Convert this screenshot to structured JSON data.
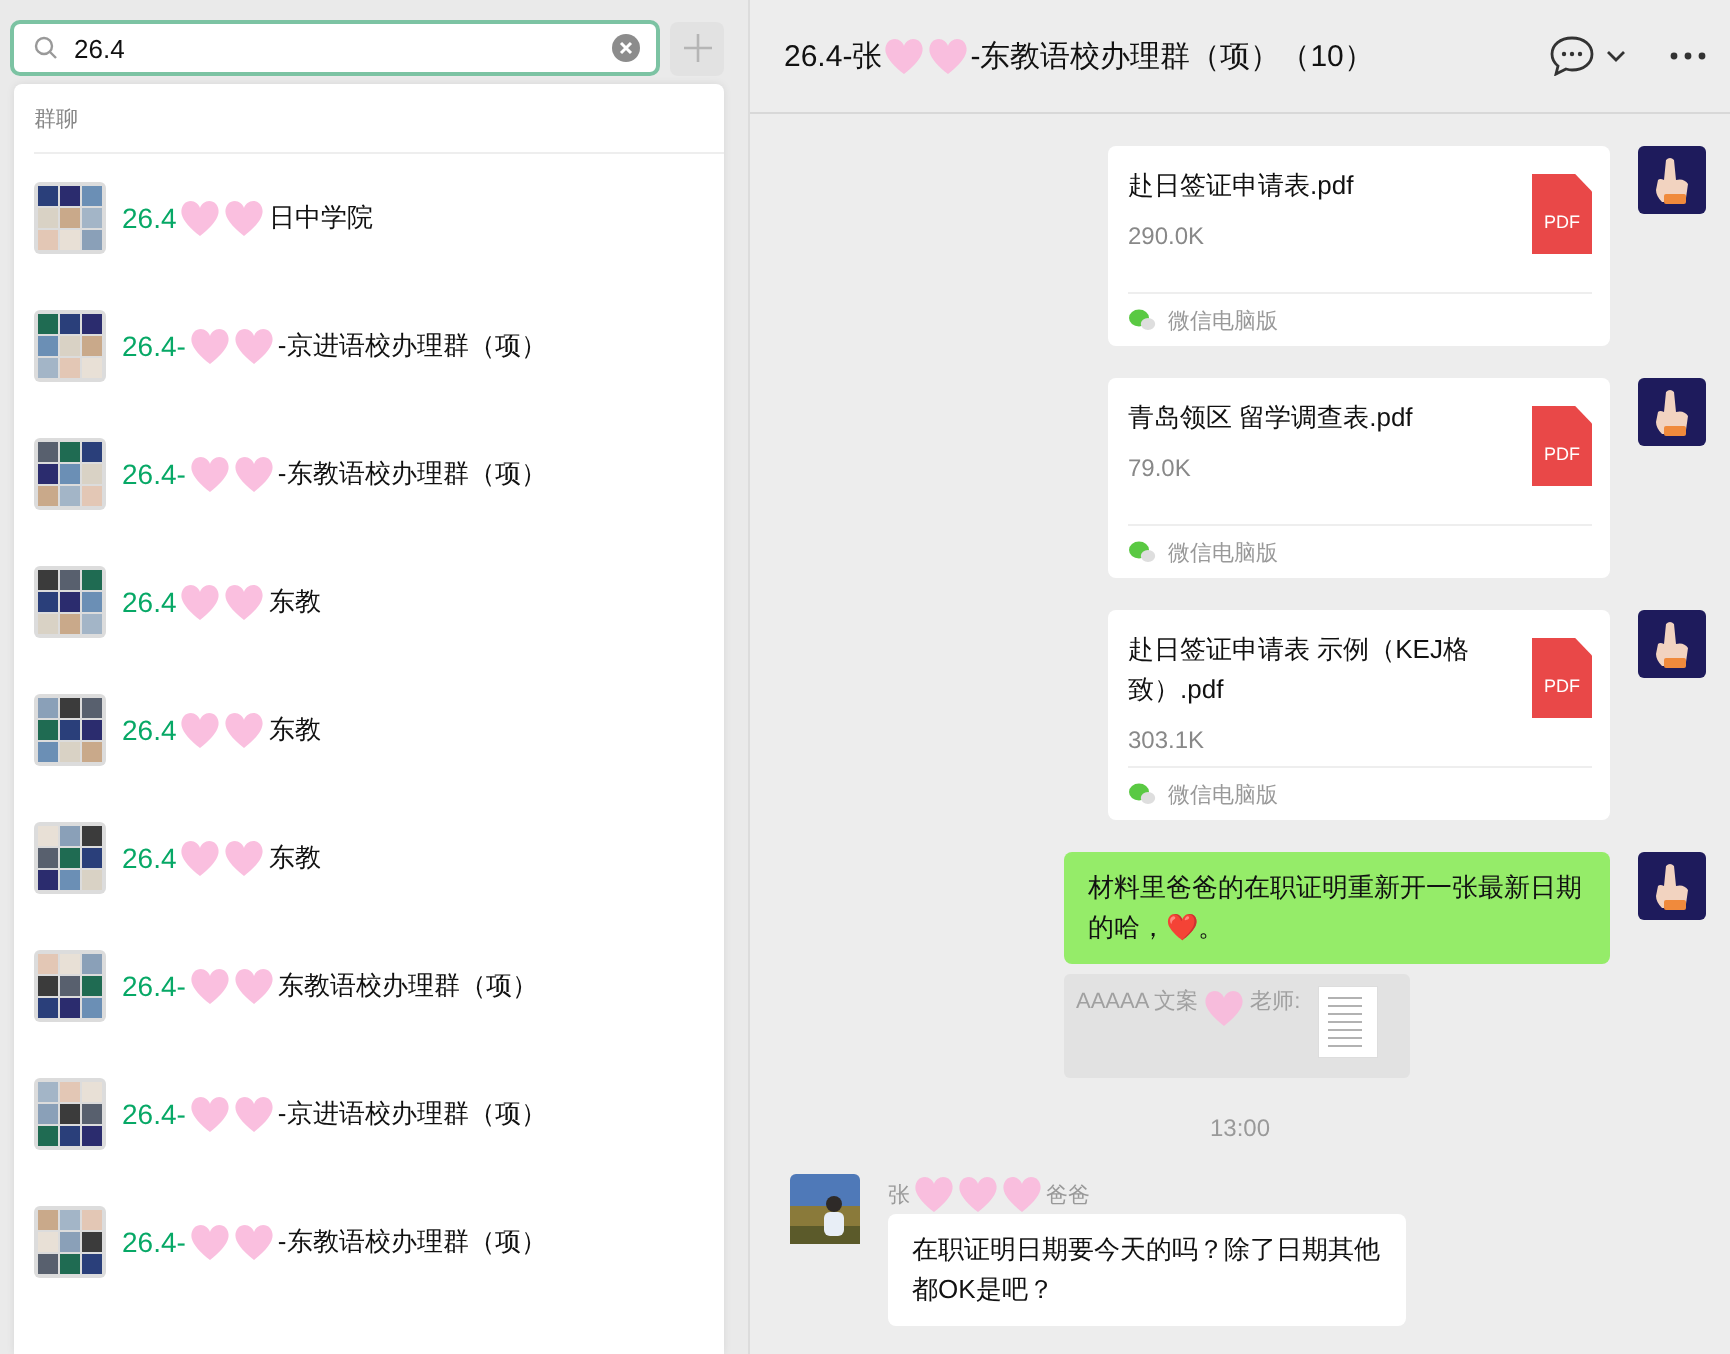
{
  "search": {
    "value": "26.4"
  },
  "results": {
    "section": "群聊",
    "items": [
      {
        "match": "26.4",
        "rest": "日中学院"
      },
      {
        "match": "26.4-",
        "rest": "-京进语校办理群（项）"
      },
      {
        "match": "26.4-",
        "rest": "-东教语校办理群（项）"
      },
      {
        "match": "26.4",
        "rest": "东教"
      },
      {
        "match": "26.4",
        "rest": "东教"
      },
      {
        "match": "26.4",
        "rest": "东教"
      },
      {
        "match": "26.4-",
        "rest": "东教语校办理群（项）"
      },
      {
        "match": "26.4-",
        "rest": "-京进语校办理群（项）"
      },
      {
        "match": "26.4-",
        "rest": "-东教语校办理群（项）"
      }
    ]
  },
  "chat": {
    "title_start": "26.4-张",
    "title_end": "-东教语校办理群（项）（10）",
    "messages": [
      {
        "kind": "file",
        "name": "赴日签证申请表.pdf",
        "size": "290.0K",
        "source": "微信电脑版",
        "badge": "PDF"
      },
      {
        "kind": "file",
        "name": "青岛领区 留学调查表.pdf",
        "size": "79.0K",
        "source": "微信电脑版",
        "badge": "PDF"
      },
      {
        "kind": "file",
        "name": "赴日签证申请表 示例（KEJ格致）.pdf",
        "size": "303.1K",
        "source": "微信电脑版",
        "badge": "PDF"
      },
      {
        "kind": "text",
        "text": "材料里爸爸的在职证明重新开一张最新日期的哈，❤️。"
      },
      {
        "kind": "quote",
        "start": "AAAAA 文案",
        "end": "老师:"
      },
      {
        "kind": "time",
        "text": "13:00"
      },
      {
        "kind": "incoming",
        "sender_start": "张",
        "sender_end": "爸爸",
        "text": "在职证明日期要今天的吗？除了日期其他都OK是吧？"
      }
    ]
  }
}
